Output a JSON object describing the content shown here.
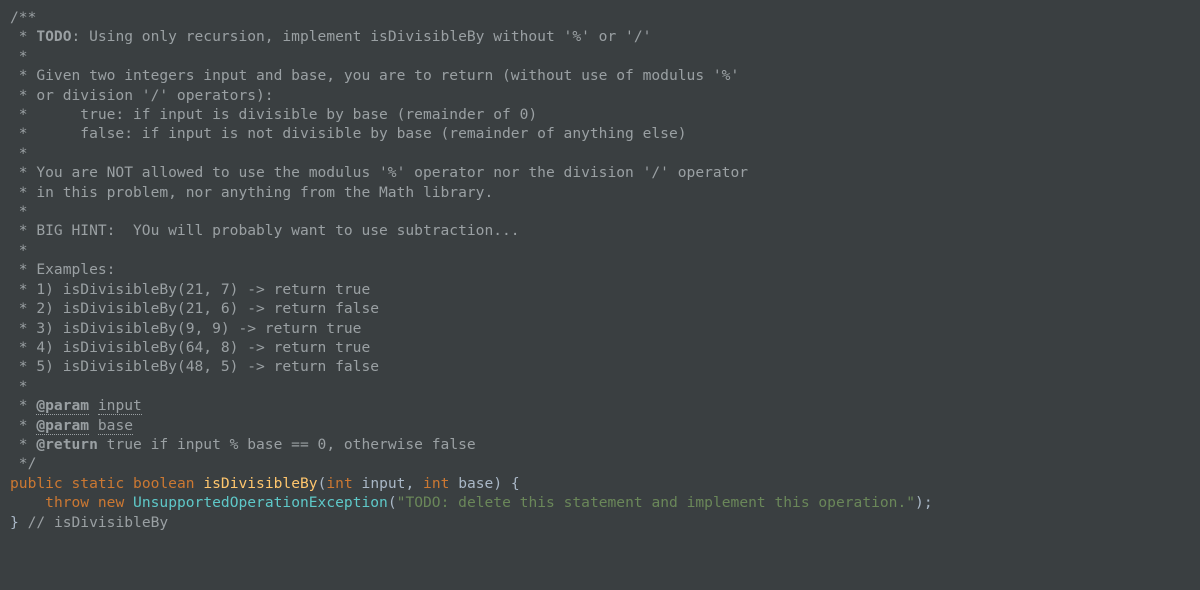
{
  "doc": {
    "l01": "/**",
    "l02_star": " * ",
    "l02_todo": "TODO",
    "l02_rest": ": Using only recursion, implement isDivisibleBy without '%' or '/'",
    "l03": " *",
    "l04": " * Given two integers input and base, you are to return (without use of modulus '%'",
    "l05": " * or division '/' operators):",
    "l06": " *      true: if input is divisible by base (remainder of 0)",
    "l07": " *      false: if input is not divisible by base (remainder of anything else)",
    "l08": " *",
    "l09": " * You are NOT allowed to use the modulus '%' operator nor the division '/' operator",
    "l10": " * in this problem, nor anything from the Math library.",
    "l11": " *",
    "l12": " * BIG HINT:  YOu will probably want to use subtraction...",
    "l13": " *",
    "l14": " * Examples:",
    "l15": " * 1) isDivisibleBy(21, 7) -> return true",
    "l16": " * 2) isDivisibleBy(21, 6) -> return false",
    "l17": " * 3) isDivisibleBy(9, 9) -> return true",
    "l18": " * 4) isDivisibleBy(64, 8) -> return true",
    "l19": " * 5) isDivisibleBy(48, 5) -> return false",
    "l20": " *",
    "l21_star": " * ",
    "l21_tag": "@param",
    "l21_sp": " ",
    "l21_name": "input",
    "l22_star": " * ",
    "l22_tag": "@param",
    "l22_sp": " ",
    "l22_name": "base",
    "l23_star": " * ",
    "l23_tag": "@return",
    "l23_rest": " true if input % base == 0, otherwise false",
    "l24": " */"
  },
  "code": {
    "l25_kw1": "public",
    "l25_sp1": " ",
    "l25_kw2": "static",
    "l25_sp2": " ",
    "l25_kw3": "boolean",
    "l25_sp3": " ",
    "l25_name": "isDivisibleBy",
    "l25_lp": "(",
    "l25_t1": "int",
    "l25_sp4": " ",
    "l25_p1": "input",
    "l25_c1": ", ",
    "l25_t2": "int",
    "l25_sp5": " ",
    "l25_p2": "base",
    "l25_rp_b": ") {",
    "l26_indent": "    ",
    "l26_kw1": "throw",
    "l26_sp1": " ",
    "l26_kw2": "new",
    "l26_sp2": " ",
    "l26_call": "UnsupportedOperationException",
    "l26_lp": "(",
    "l26_str": "\"TODO: delete this statement and implement this operation.\"",
    "l26_rp": ");",
    "l27_brace": "}",
    "l27_sp": " ",
    "l27_comment": "// isDivisibleBy"
  }
}
